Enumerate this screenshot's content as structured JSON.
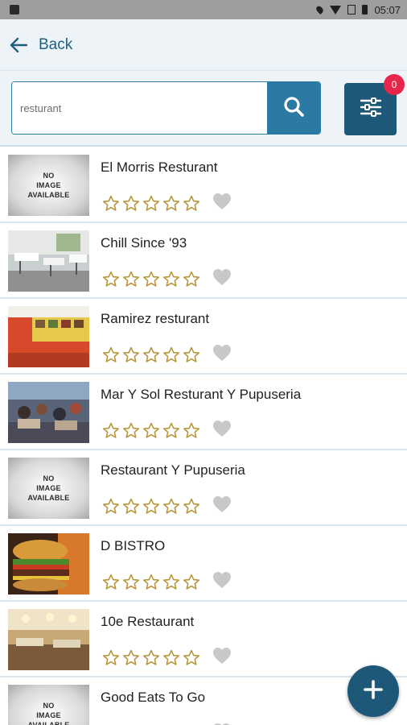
{
  "status_bar": {
    "time": "05:07"
  },
  "nav": {
    "back_label": "Back"
  },
  "search": {
    "value": "resturant",
    "placeholder": "resturant"
  },
  "filter": {
    "badge_count": "0"
  },
  "no_image_text": "NO\nIMAGE\nAVAILABLE",
  "colors": {
    "primary": "#1d5878",
    "accent": "#2a7aa3",
    "badge": "#e8254b",
    "star": "#b8963a",
    "heart": "#c8c8c8"
  },
  "listings": [
    {
      "name": "El Morris Resturant",
      "image": "none",
      "rating": 0,
      "favorite": false
    },
    {
      "name": "Chill Since '93",
      "image": "photo-dining-room",
      "rating": 0,
      "favorite": false
    },
    {
      "name": "Ramirez resturant",
      "image": "photo-menu-wall",
      "rating": 0,
      "favorite": false
    },
    {
      "name": "Mar Y Sol Resturant Y Pupuseria",
      "image": "photo-crowd",
      "rating": 0,
      "favorite": false
    },
    {
      "name": "Restaurant Y Pupuseria",
      "image": "none",
      "rating": 0,
      "favorite": false
    },
    {
      "name": "D BISTRO",
      "image": "photo-burger",
      "rating": 0,
      "favorite": false
    },
    {
      "name": "10e Restaurant",
      "image": "photo-interior",
      "rating": 0,
      "favorite": false
    },
    {
      "name": "Good Eats To Go",
      "image": "none",
      "rating": 0,
      "favorite": false
    }
  ]
}
